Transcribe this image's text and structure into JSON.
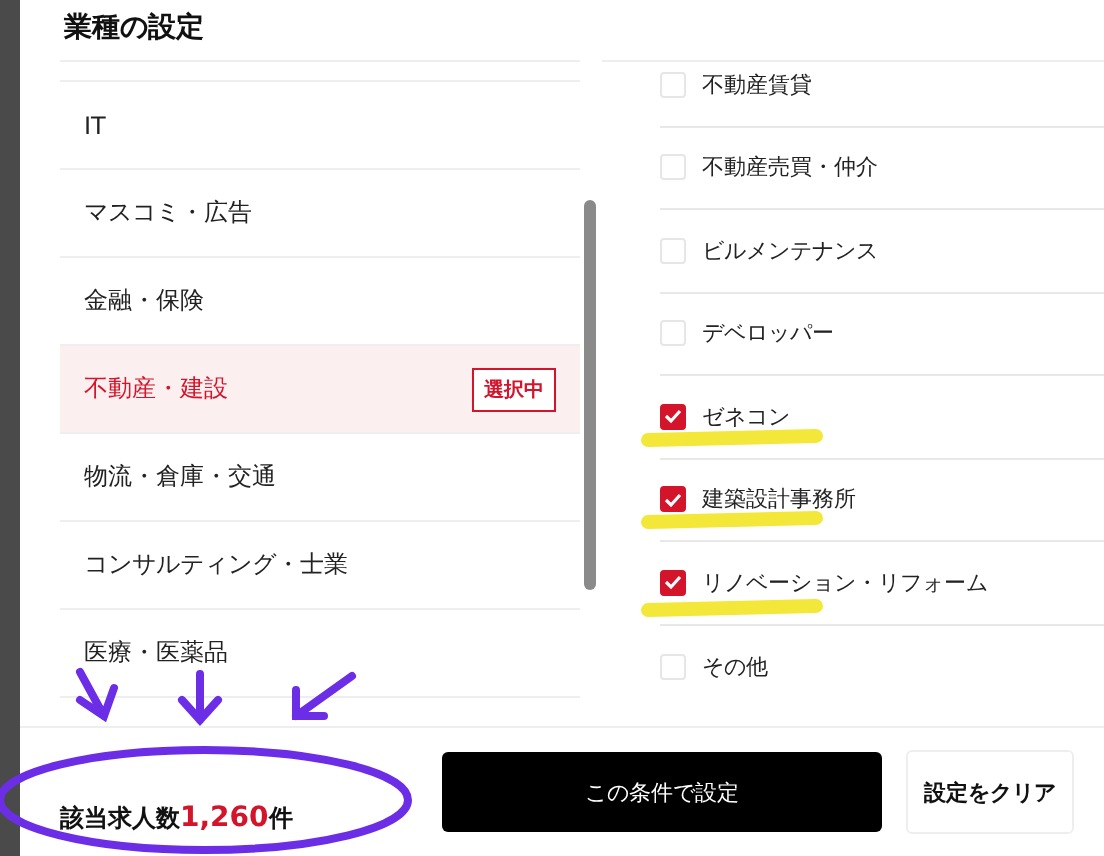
{
  "title": "業種の設定",
  "industries": [
    {
      "label": "IT",
      "selected": false
    },
    {
      "label": "マスコミ・広告",
      "selected": false
    },
    {
      "label": "金融・保険",
      "selected": false
    },
    {
      "label": "不動産・建設",
      "selected": true
    },
    {
      "label": "物流・倉庫・交通",
      "selected": false
    },
    {
      "label": "コンサルティング・士業",
      "selected": false
    },
    {
      "label": "医療・医薬品",
      "selected": false
    }
  ],
  "selected_badge": "選択中",
  "sub_industries": [
    {
      "label": "不動産賃貸",
      "checked": false
    },
    {
      "label": "不動産売買・仲介",
      "checked": false
    },
    {
      "label": "ビルメンテナンス",
      "checked": false
    },
    {
      "label": "デベロッパー",
      "checked": false
    },
    {
      "label": "ゼネコン",
      "checked": true
    },
    {
      "label": "建築設計事務所",
      "checked": true
    },
    {
      "label": "リノベーション・リフォーム",
      "checked": true
    },
    {
      "label": "その他",
      "checked": false
    }
  ],
  "footer": {
    "result_label": "該当求人数",
    "result_count": "1,260",
    "result_unit": "件",
    "apply_button": "この条件で設定",
    "clear_button": "設定をクリア"
  }
}
